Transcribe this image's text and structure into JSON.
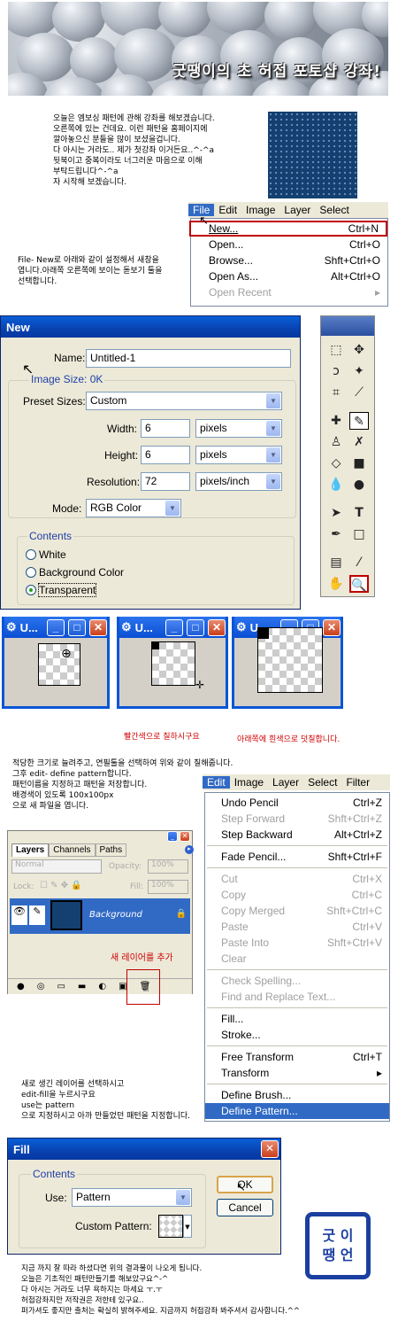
{
  "banner": {
    "title": "굿땡이의 초 허접 포토샵 강좌!"
  },
  "intro": {
    "text": "오늘은 엠보싱 패턴에 관해 강좌를 해보겠습니다.\n오른쪽에 있는 건데요. 이런 패턴을 홈페이지에\n깔아놓으신 분들을 많이 보셨을겁니다.\n다 아시는 거라도.. 제가 첫강좌 이거든요..^-^a\n뒷북이고 중복이라도 너그러운 마음으로 이해\n부탁드립니다^-^a\n자 시작해 보겠습니다."
  },
  "file_menu": {
    "bar": [
      "File",
      "Edit",
      "Image",
      "Layer",
      "Select"
    ],
    "items": [
      {
        "label": "New...",
        "shortcut": "Ctrl+N",
        "state": "highlight"
      },
      {
        "label": "Open...",
        "shortcut": "Ctrl+O",
        "state": "normal"
      },
      {
        "label": "Browse...",
        "shortcut": "Shft+Ctrl+O",
        "state": "normal"
      },
      {
        "label": "Open As...",
        "shortcut": "Alt+Ctrl+O",
        "state": "normal"
      },
      {
        "label": "Open Recent",
        "shortcut": "▸",
        "state": "disabled"
      }
    ]
  },
  "step1_text": "File- New로 아래와 같이 설정해서 새창을\n엽니다.아래쪽 오른쪽에 보이는 돋보기 툴을\n선택합니다.",
  "new_dialog": {
    "title": "New",
    "name_label": "Name:",
    "name_value": "Untitled-1",
    "image_size": "Image Size: 0K",
    "preset_label": "Preset Sizes:",
    "preset_value": "Custom",
    "width_label": "Width:",
    "width_value": "6",
    "width_unit": "pixels",
    "height_label": "Height:",
    "height_value": "6",
    "height_unit": "pixels",
    "res_label": "Resolution:",
    "res_value": "72",
    "res_unit": "pixels/inch",
    "mode_label": "Mode:",
    "mode_value": "RGB Color",
    "contents_label": "Contents",
    "options": [
      "White",
      "Background Color",
      "Transparent"
    ],
    "selected": "Transparent"
  },
  "small_windows": {
    "title": "U..."
  },
  "captions": {
    "left": "빨간색으로 칠하시구요",
    "right": "아래쪽에 흰색으로 덧칠합니다."
  },
  "step2_text": "적당한 크기로 늘려주고, 연필툴을 선택하여 위와 같이 칠해줍니다.\n그후 edit- define pattern합니다.\n패턴이름을 지정하고 패턴을 저장합니다.\n배경색이 있도록 100x100px\n으로 새 파일을 엽니다.",
  "edit_menu": {
    "bar": [
      "Edit",
      "Image",
      "Layer",
      "Select",
      "Filter"
    ],
    "items": [
      {
        "label": "Undo Pencil",
        "shortcut": "Ctrl+Z",
        "state": "normal"
      },
      {
        "label": "Step Forward",
        "shortcut": "Shft+Ctrl+Z",
        "state": "disabled"
      },
      {
        "label": "Step Backward",
        "shortcut": "Alt+Ctrl+Z",
        "state": "normal"
      },
      {
        "sep": true
      },
      {
        "label": "Fade Pencil...",
        "shortcut": "Shft+Ctrl+F",
        "state": "normal"
      },
      {
        "sep": true
      },
      {
        "label": "Cut",
        "shortcut": "Ctrl+X",
        "state": "disabled"
      },
      {
        "label": "Copy",
        "shortcut": "Ctrl+C",
        "state": "disabled"
      },
      {
        "label": "Copy Merged",
        "shortcut": "Shft+Ctrl+C",
        "state": "disabled"
      },
      {
        "label": "Paste",
        "shortcut": "Ctrl+V",
        "state": "disabled"
      },
      {
        "label": "Paste Into",
        "shortcut": "Shft+Ctrl+V",
        "state": "disabled"
      },
      {
        "label": "Clear",
        "shortcut": "",
        "state": "disabled"
      },
      {
        "sep": true
      },
      {
        "label": "Check Spelling...",
        "shortcut": "",
        "state": "disabled"
      },
      {
        "label": "Find and Replace Text...",
        "shortcut": "",
        "state": "disabled"
      },
      {
        "sep": true
      },
      {
        "label": "Fill...",
        "shortcut": "",
        "state": "normal"
      },
      {
        "label": "Stroke...",
        "shortcut": "",
        "state": "normal"
      },
      {
        "sep": true
      },
      {
        "label": "Free Transform",
        "shortcut": "Ctrl+T",
        "state": "normal"
      },
      {
        "label": "Transform",
        "shortcut": "▸",
        "state": "normal"
      },
      {
        "sep": true
      },
      {
        "label": "Define Brush...",
        "shortcut": "",
        "state": "normal"
      },
      {
        "label": "Define Pattern...",
        "shortcut": "",
        "state": "selected"
      }
    ]
  },
  "layers": {
    "tabs": [
      "Layers",
      "Channels",
      "Paths"
    ],
    "blend": "Normal",
    "opacity_label": "Opacity:",
    "opacity": "100%",
    "lock_label": "Lock:",
    "fill_label": "Fill:",
    "fill": "100%",
    "layer_name": "Background",
    "note": "새 레이어를 추가"
  },
  "step3_text": "새로 생긴 레이어를 선택하시고\nedit-fill을 누르시구요\nuse는 pattern\n으로 지정하시고 아까 만들었던 패턴을 지정합니다.",
  "fill_dialog": {
    "title": "Fill",
    "contents_label": "Contents",
    "use_label": "Use:",
    "use_value": "Pattern",
    "custom_label": "Custom Pattern:",
    "ok": "OK",
    "cancel": "Cancel"
  },
  "stamp": {
    "text": "굿 이\n땡 언"
  },
  "outro": "지금 까지 잘 따라 하셨다면 위의 결과물이 나오게 됩니다.\n오늘은 기초적인 패턴만들기를 해보았구요^-^\n다 아시는 거라도 너무 욕하지는 마세요 ㅜ.ㅜ\n허접강좌지만 저작권은 저한테 있구요..\n퍼가셔도 좋지만 출처는 확실히 밝혀주세요. 지금까지 허접강좌 봐주셔서 감사합니다.^^"
}
